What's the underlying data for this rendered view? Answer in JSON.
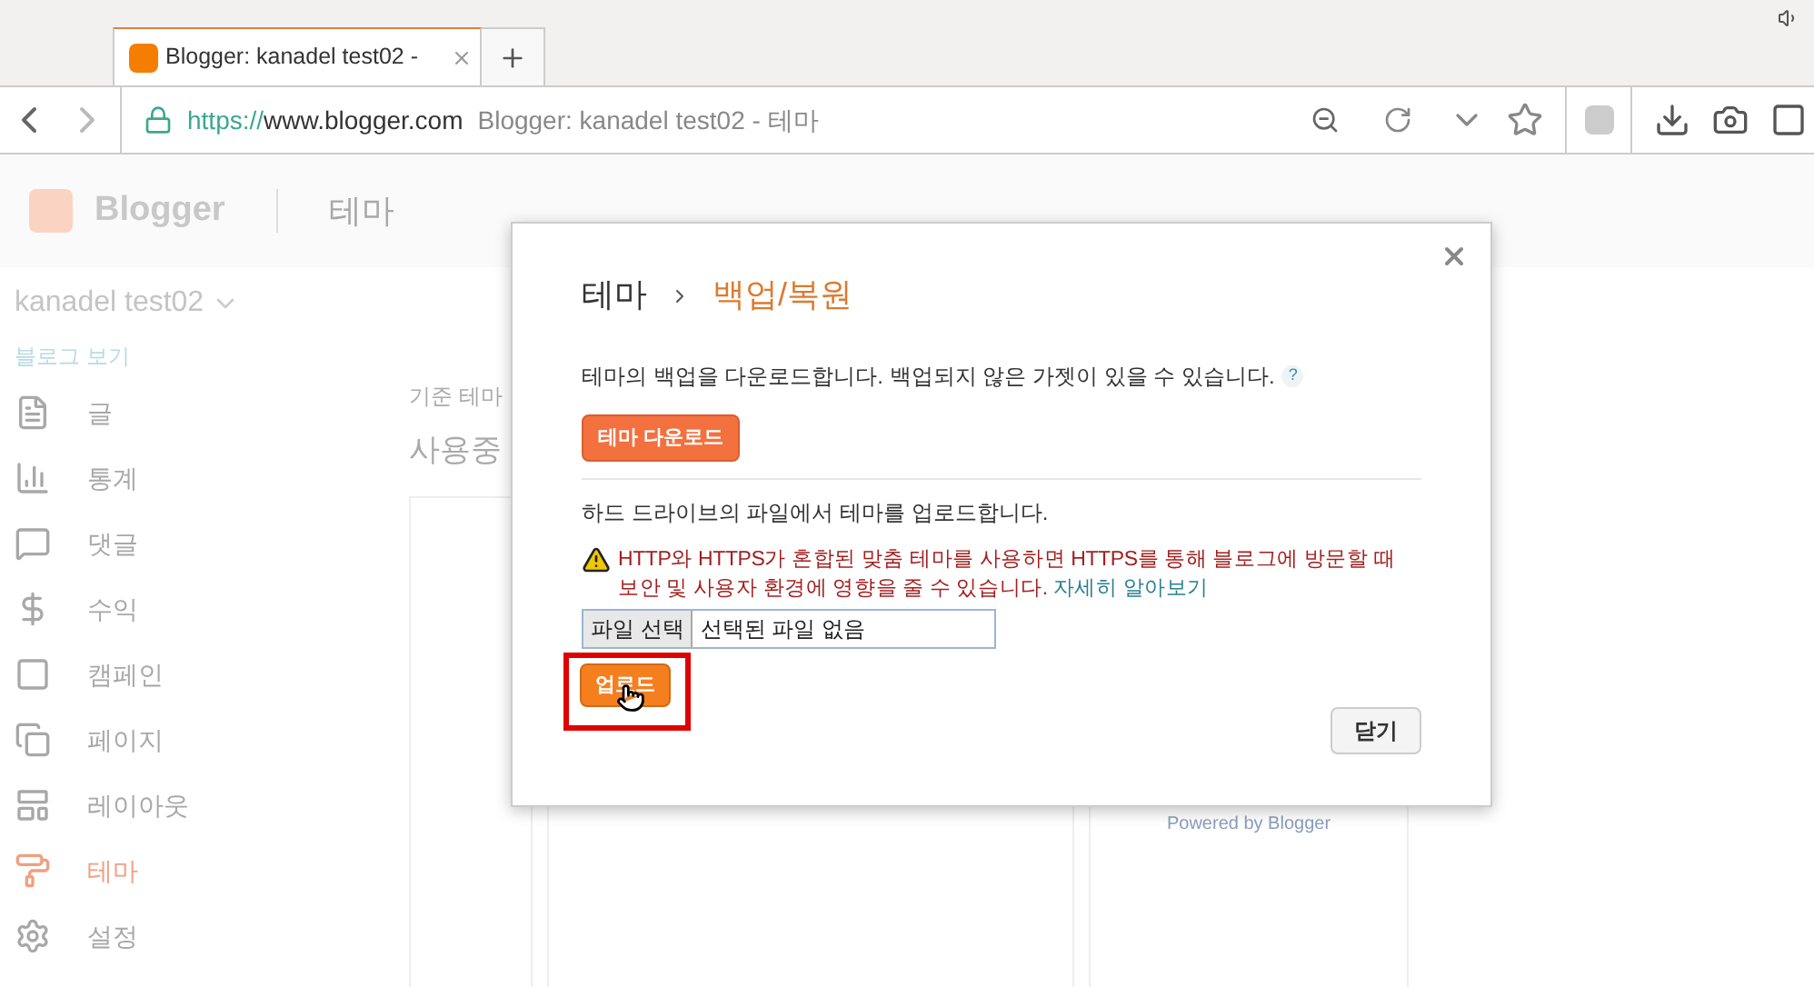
{
  "browser": {
    "tab_title": "Blogger: kanadel test02 -",
    "url_scheme": "https://",
    "url_host": "www.blogger.com",
    "page_title": "Blogger: kanadel test02 - 테마"
  },
  "header": {
    "logo": "Blogger",
    "section": "테마"
  },
  "blog": {
    "name": "kanadel test02",
    "view_link": "블로그 보기"
  },
  "sidebar": {
    "items": [
      {
        "label": "글",
        "selected": false
      },
      {
        "label": "통계",
        "selected": false
      },
      {
        "label": "댓글",
        "selected": false
      },
      {
        "label": "수익",
        "selected": false
      },
      {
        "label": "캠페인",
        "selected": false
      },
      {
        "label": "페이지",
        "selected": false
      },
      {
        "label": "레이아웃",
        "selected": false
      },
      {
        "label": "테마",
        "selected": true
      },
      {
        "label": "설정",
        "selected": false
      }
    ]
  },
  "main": {
    "subtitle": "기준 테마",
    "heading": "사용중",
    "card_footer": "Powered by Blogger"
  },
  "dialog": {
    "crumb_parent": "테마",
    "crumb_current": "백업/복원",
    "download_text": "테마의 백업을 다운로드합니다. 백업되지 않은 가젯이 있을 수 있습니다.",
    "help": "?",
    "download_button": "테마 다운로드",
    "upload_text": "하드 드라이브의 파일에서 테마를 업로드합니다.",
    "warning": "HTTP와 HTTPS가 혼합된 맞춤 테마를 사용하면 HTTPS를 통해 블로그에 방문할 때 보안 및 사용자 환경에 영향을 줄 수 있습니다.",
    "learn_more": "자세히 알아보기",
    "file_button": "파일 선택",
    "file_status": "선택된 파일 없음",
    "upload_button": "업로드",
    "close_button": "닫기"
  }
}
